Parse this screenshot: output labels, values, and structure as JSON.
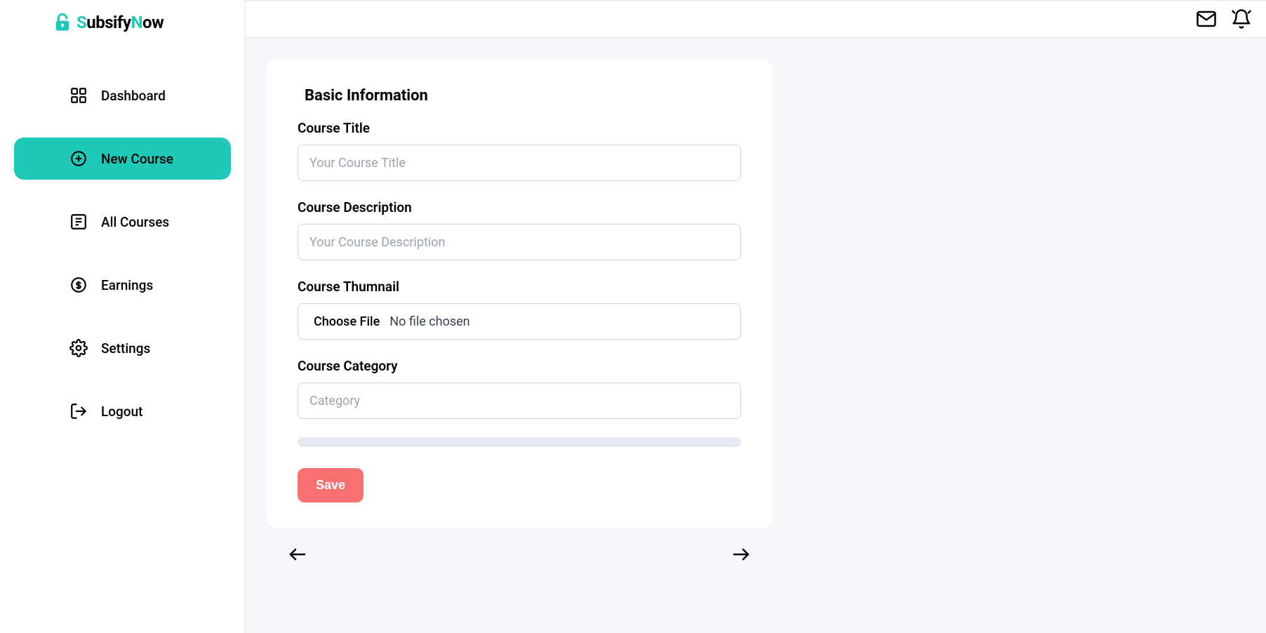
{
  "brand": {
    "part1": "S",
    "part2": "ubsify",
    "part3": "N",
    "part4": "ow"
  },
  "sidebar": {
    "items": [
      {
        "label": "Dashboard"
      },
      {
        "label": "New Course"
      },
      {
        "label": "All Courses"
      },
      {
        "label": "Earnings"
      },
      {
        "label": "Settings"
      },
      {
        "label": "Logout"
      }
    ]
  },
  "form": {
    "section_title": "Basic Information",
    "title_label": "Course Title",
    "title_placeholder": "Your Course Title",
    "description_label": "Course Description",
    "description_placeholder": "Your Course Description",
    "thumbnail_label": "Course Thumnail",
    "file_choose": "Choose File",
    "file_status": "No file chosen",
    "category_label": "Course Category",
    "category_placeholder": "Category",
    "save_label": "Save"
  }
}
